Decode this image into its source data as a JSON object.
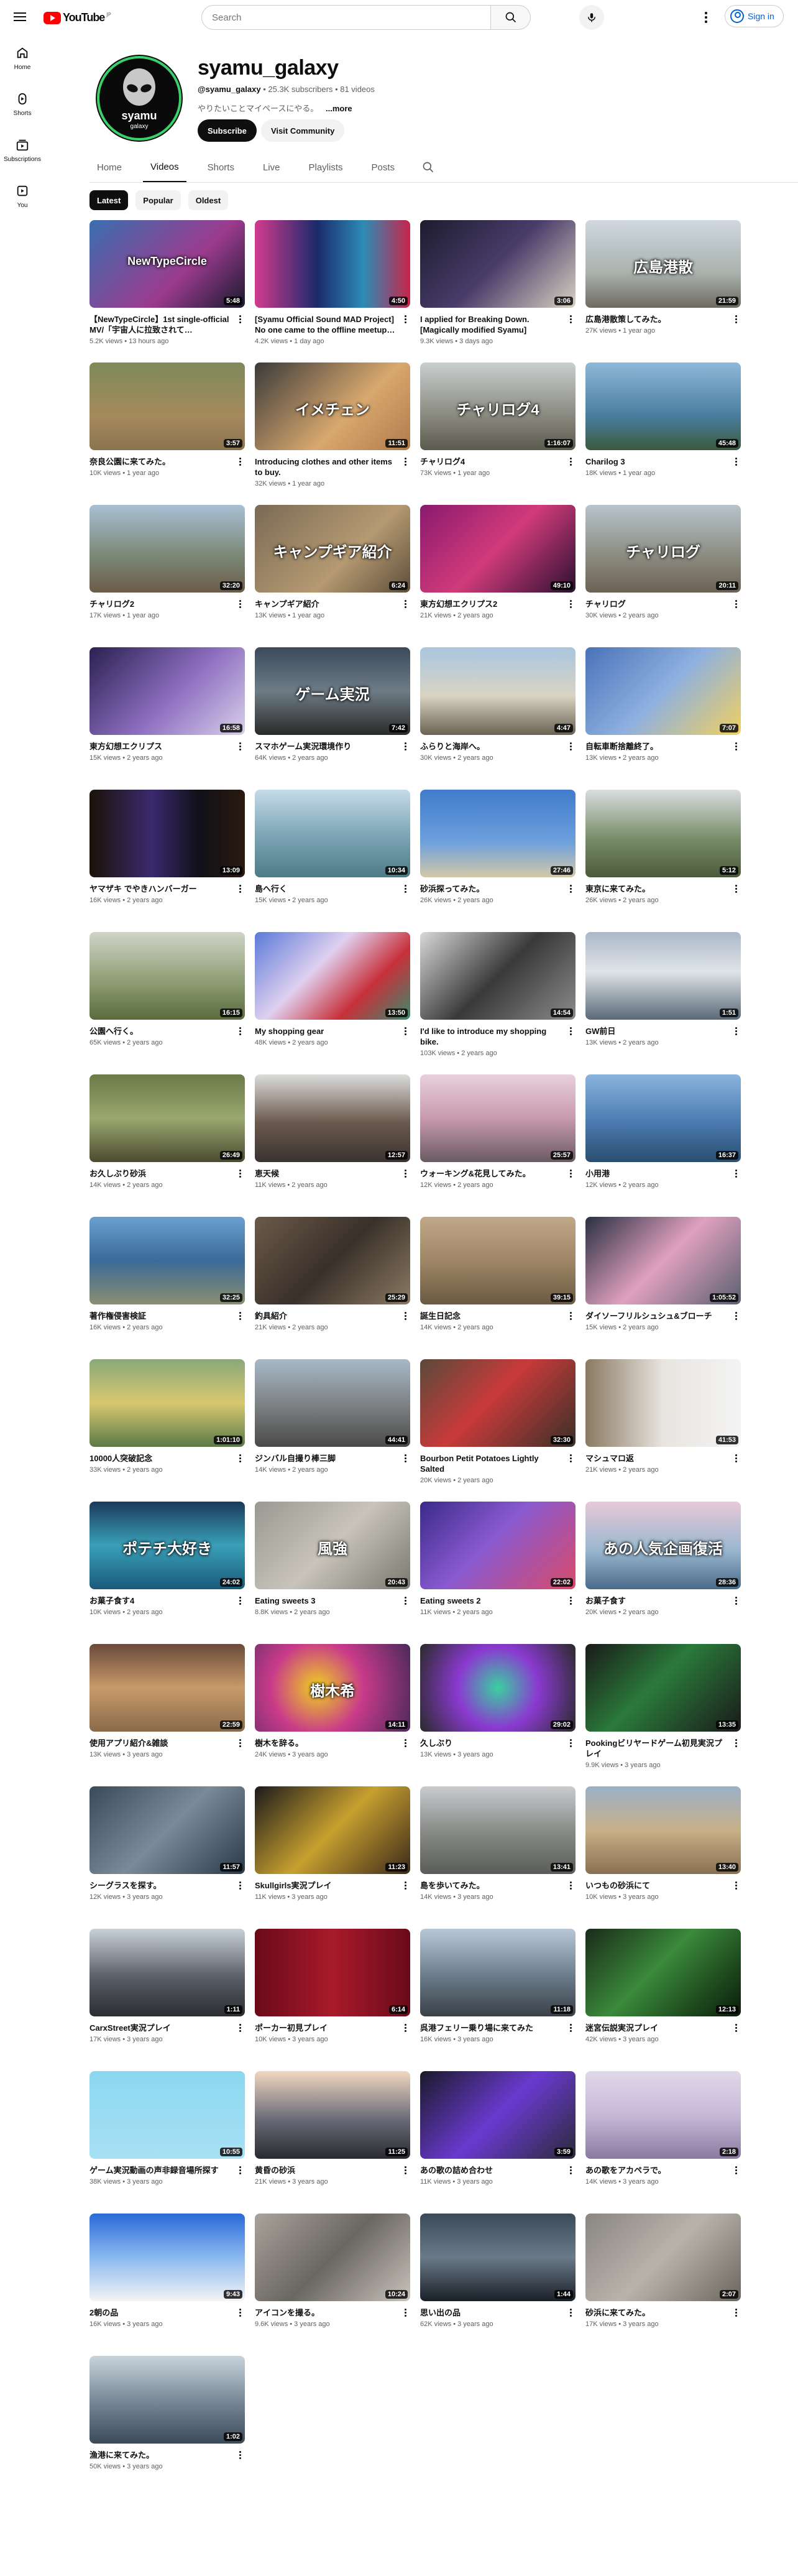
{
  "header": {
    "logo_text": "YouTube",
    "logo_country": "JP",
    "search_placeholder": "Search",
    "sign_in_label": "Sign in"
  },
  "sidebar": {
    "items": [
      {
        "label": "Home",
        "icon": "home-icon"
      },
      {
        "label": "Shorts",
        "icon": "shorts-icon"
      },
      {
        "label": "Subscriptions",
        "icon": "subscriptions-icon"
      },
      {
        "label": "You",
        "icon": "you-icon"
      }
    ]
  },
  "channel": {
    "name": "syamu_galaxy",
    "handle": "@syamu_galaxy",
    "subscribers": "25.3K subscribers",
    "videos": "81 videos",
    "description": "やりたいことマイペースにやる。",
    "more_label": "...more",
    "subscribe_label": "Subscribe",
    "community_label": "Visit Community",
    "avatar_text": "syamu",
    "avatar_subtext": "galaxy"
  },
  "tabs": [
    "Home",
    "Videos",
    "Shorts",
    "Live",
    "Playlists",
    "Posts"
  ],
  "active_tab": "Videos",
  "chips": [
    "Latest",
    "Popular",
    "Oldest"
  ],
  "active_chip": "Latest",
  "colors": {
    "accent": "#065fd4",
    "logo_red": "#ff0000",
    "text": "#0f0f0f",
    "muted": "#606060"
  },
  "videos": [
    {
      "title": "【NewTypeCircle】1st single-official MV/「宇宙人に拉致されて…",
      "meta": "5.2K views • 13 hours ago",
      "duration": "5:48",
      "thumb_text": "NewTypeCircle",
      "bg": "linear-gradient(135deg,#3a6fb0,#9c3b8e 60%,#1a1a2e)"
    },
    {
      "title": "[Syamu Official Sound MAD Project] No one came to the offline meetup…",
      "meta": "4.2K views • 1 day ago",
      "duration": "4:50",
      "thumb_text": "",
      "bg": "linear-gradient(90deg,#d23b8e,#1b2a6b 40%,#2d8bb6 70%,#c8244a)"
    },
    {
      "title": "I applied for Breaking Down. [Magically modified Syamu]",
      "meta": "9.3K views • 3 days ago",
      "duration": "3:06",
      "thumb_text": "",
      "bg": "linear-gradient(135deg,#1c1c2e,#4a3d6b 50%,#d9d2c0)"
    },
    {
      "title": "広島港散策してみた。",
      "meta": "27K views • 1 year ago",
      "duration": "21:59",
      "thumb_text": "広島港散",
      "bg": "linear-gradient(180deg,#cfd8e0,#a9b2ad 60%,#6e6a60)"
    },
    {
      "title": "奈良公園に来てみた。",
      "meta": "10K views • 1 year ago",
      "duration": "3:57",
      "thumb_text": "",
      "bg": "linear-gradient(180deg,#7d8a5a,#a58a5c 60%,#8a7350)"
    },
    {
      "title": "Introducing clothes and other items to buy.",
      "meta": "32K views • 1 year ago",
      "duration": "11:51",
      "thumb_text": "イメチェン",
      "bg": "linear-gradient(135deg,#3a3a3a,#d8a86e 60%,#b17a4c)"
    },
    {
      "title": "チャリログ4",
      "meta": "73K views • 1 year ago",
      "duration": "1:16:07",
      "thumb_text": "チャリログ4",
      "bg": "linear-gradient(180deg,#c9cfcf,#8a8a80 60%,#5a5a4e)"
    },
    {
      "title": "Charilog 3",
      "meta": "18K views • 1 year ago",
      "duration": "45:48",
      "thumb_text": "",
      "bg": "linear-gradient(180deg,#8fb8d8,#4a7ea0 60%,#3a5a3e)"
    },
    {
      "title": "チャリログ2",
      "meta": "17K views • 1 year ago",
      "duration": "32:20",
      "thumb_text": "",
      "bg": "linear-gradient(180deg,#a9bfd4,#7d8b7a 55%,#6a5b48)"
    },
    {
      "title": "キャンプギア紹介",
      "meta": "13K views • 1 year ago",
      "duration": "6:24",
      "thumb_text": "キャンプギア紹介",
      "bg": "linear-gradient(135deg,#7a6a55,#b59a72 60%,#5e4e3a)"
    },
    {
      "title": "東方幻想エクリプス2",
      "meta": "21K views • 2 years ago",
      "duration": "49:10",
      "thumb_text": "",
      "bg": "linear-gradient(135deg,#8a1a6e,#d13b7a 50%,#2a1030)"
    },
    {
      "title": "チャリログ",
      "meta": "30K views • 2 years ago",
      "duration": "20:11",
      "thumb_text": "チャリログ",
      "bg": "linear-gradient(180deg,#b7c4cc,#8a8a7e 60%,#6b6254)"
    },
    {
      "title": "東方幻想エクリプス",
      "meta": "15K views • 2 years ago",
      "duration": "16:58",
      "thumb_text": "",
      "bg": "linear-gradient(135deg,#2a2150,#8e6fc2 55%,#d8d0e8)"
    },
    {
      "title": "スマホゲーム実況環境作り",
      "meta": "64K views • 2 years ago",
      "duration": "7:42",
      "thumb_text": "ゲーム実況",
      "bg": "linear-gradient(180deg,#3b4a5a,#6e7c86 50%,#2a2a2a)"
    },
    {
      "title": "ふらりと海岸へ。",
      "meta": "30K views • 2 years ago",
      "duration": "4:47",
      "thumb_text": "",
      "bg": "linear-gradient(180deg,#a9c6df,#d9d4c4 55%,#6a6252)"
    },
    {
      "title": "自転車断捨離終了。",
      "meta": "13K views • 2 years ago",
      "duration": "7:07",
      "thumb_text": "",
      "bg": "linear-gradient(135deg,#4a72b8,#8eb0e0 50%,#f0d060)"
    },
    {
      "title": "ヤマザキ でやきハンバーガー",
      "meta": "16K views • 2 years ago",
      "duration": "13:09",
      "thumb_text": "",
      "bg": "linear-gradient(90deg,#1a1208,#3a2a6e 40%,#101018 70%,#2a1a10)"
    },
    {
      "title": "島へ行く",
      "meta": "15K views • 2 years ago",
      "duration": "10:34",
      "thumb_text": "",
      "bg": "linear-gradient(180deg,#c6dbe8,#7fa7b8 50%,#4e7a86)"
    },
    {
      "title": "砂浜探ってみた。",
      "meta": "26K views • 2 years ago",
      "duration": "27:46",
      "thumb_text": "",
      "bg": "linear-gradient(180deg,#3f7ccc,#6ea0dc 60%,#d4c8a8)"
    },
    {
      "title": "東京に来てみた。",
      "meta": "26K views • 2 years ago",
      "duration": "5:12",
      "thumb_text": "",
      "bg": "linear-gradient(180deg,#d8dee0,#7a8e6a 55%,#4a5a3a)"
    },
    {
      "title": "公園へ行く。",
      "meta": "65K views • 2 years ago",
      "duration": "16:15",
      "thumb_text": "",
      "bg": "linear-gradient(180deg,#cfd4c8,#8a9a6e 60%,#5a6b3e)"
    },
    {
      "title": "My shopping gear",
      "meta": "48K views • 2 years ago",
      "duration": "13:50",
      "thumb_text": "",
      "bg": "linear-gradient(135deg,#5a7ad8,#e0d0f0 40%,#c8303a 70%,#3a8a6e)"
    },
    {
      "title": "I'd like to introduce my shopping bike.",
      "meta": "103K views • 2 years ago",
      "duration": "14:54",
      "thumb_text": "",
      "bg": "linear-gradient(135deg,#d8d8d8,#3a3a3a 50%,#8a8a8a)"
    },
    {
      "title": "GW前日",
      "meta": "13K views • 2 years ago",
      "duration": "1:51",
      "thumb_text": "",
      "bg": "linear-gradient(180deg,#a9b8c8,#e0e4e8 45%,#5a6a78)"
    },
    {
      "title": "お久しぶり砂浜",
      "meta": "14K views • 2 years ago",
      "duration": "26:49",
      "thumb_text": "",
      "bg": "linear-gradient(180deg,#6a7a48,#9aa86e 50%,#4a4a30)"
    },
    {
      "title": "恵天候",
      "meta": "11K views • 2 years ago",
      "duration": "12:57",
      "thumb_text": "",
      "bg": "linear-gradient(180deg,#dcdcdc,#6a5a4e 55%,#3a3230)"
    },
    {
      "title": "ウォーキング&花見してみた。",
      "meta": "12K views • 2 years ago",
      "duration": "25:57",
      "thumb_text": "",
      "bg": "linear-gradient(180deg,#e8d0dc,#c89aae 50%,#6a5a62)"
    },
    {
      "title": "小用港",
      "meta": "12K views • 2 years ago",
      "duration": "16:37",
      "thumb_text": "",
      "bg": "linear-gradient(180deg,#8ab4de,#4a7ab0 55%,#2a4e6e)"
    },
    {
      "title": "著作権侵害検証",
      "meta": "16K views • 2 years ago",
      "duration": "32:25",
      "thumb_text": "",
      "bg": "linear-gradient(180deg,#6aa0d0,#3a6a98 50%,#8a8e70)"
    },
    {
      "title": "釣具紹介",
      "meta": "21K views • 2 years ago",
      "duration": "25:29",
      "thumb_text": "",
      "bg": "linear-gradient(135deg,#6a5a48,#3a302a 50%,#8a7a62)"
    },
    {
      "title": "誕生日記念",
      "meta": "14K views • 2 years ago",
      "duration": "39:15",
      "thumb_text": "",
      "bg": "linear-gradient(180deg,#c0a888,#9a8262 55%,#6a5a42)"
    },
    {
      "title": "ダイソーフリルシュシュ&ブローチ",
      "meta": "15K views • 2 years ago",
      "duration": "1:05:52",
      "thumb_text": "",
      "bg": "linear-gradient(135deg,#2a3040,#e0a0c0 50%,#5a6070)"
    },
    {
      "title": "10000人突破記念",
      "meta": "33K views • 2 years ago",
      "duration": "1:01:10",
      "thumb_text": "",
      "bg": "linear-gradient(180deg,#8aa87a,#d8c870 50%,#5a7a48)"
    },
    {
      "title": "ジンバル自撮り棒三脚",
      "meta": "14K views • 2 years ago",
      "duration": "44:41",
      "thumb_text": "",
      "bg": "linear-gradient(180deg,#a8b8c8,#7a7e80 55%,#4a4a48)"
    },
    {
      "title": "Bourbon Petit Potatoes Lightly Salted",
      "meta": "20K views • 2 years ago",
      "duration": "32:30",
      "thumb_text": "",
      "bg": "linear-gradient(135deg,#5a4a3a,#c83a3a 45%,#3a3028)"
    },
    {
      "title": "マシュマロ返",
      "meta": "21K views • 2 years ago",
      "duration": "41:53",
      "thumb_text": "",
      "bg": "linear-gradient(90deg,#8a7a62,#e8e4e0 50%,#f4f4f4)"
    },
    {
      "title": "お菓子食す4",
      "meta": "10K views • 2 years ago",
      "duration": "24:02",
      "thumb_text": "ポテチ大好き",
      "bg": "linear-gradient(180deg,#1a3a5a,#3aa0b8 50%,#1a5a7a)"
    },
    {
      "title": "Eating sweets 3",
      "meta": "8.8K views • 2 years ago",
      "duration": "20:43",
      "thumb_text": "風強",
      "bg": "linear-gradient(135deg,#9a9890,#c8c4bc 50%,#7a7870)"
    },
    {
      "title": "Eating sweets 2",
      "meta": "11K views • 2 years ago",
      "duration": "22:02",
      "thumb_text": "",
      "bg": "linear-gradient(135deg,#3a2a8a,#8a5ad0 45%,#d84a6a)"
    },
    {
      "title": "お菓子食す",
      "meta": "20K views • 2 years ago",
      "duration": "28:36",
      "thumb_text": "あの人気企画復活",
      "bg": "linear-gradient(180deg,#e8c8d8,#9ab8d0 55%,#4a6a8a)"
    },
    {
      "title": "使用アプリ紹介&雑談",
      "meta": "13K views • 3 years ago",
      "duration": "22:59",
      "thumb_text": "",
      "bg": "linear-gradient(180deg,#6a4a3a,#c89a6a 50%,#8a6a4a)"
    },
    {
      "title": "樹木を辞る。",
      "meta": "24K views • 3 years ago",
      "duration": "14:11",
      "thumb_text": "樹木希",
      "bg": "radial-gradient(circle at 40% 50%,#f0d020,#c83a8a 45%,#4a2a5a)"
    },
    {
      "title": "久しぶり",
      "meta": "13K views • 3 years ago",
      "duration": "29:02",
      "thumb_text": "",
      "bg": "radial-gradient(circle at 50% 50%,#3ad0a0,#8a3ad0 45%,#2a2a2a)"
    },
    {
      "title": "Pookingビリヤードゲーム初見実況プレイ",
      "meta": "9.9K views • 3 years ago",
      "duration": "13:35",
      "thumb_text": "",
      "bg": "linear-gradient(135deg,#1a1a1a,#2a7a3a 45%,#1a1a1a)"
    },
    {
      "title": "シーグラスを探す。",
      "meta": "12K views • 3 years ago",
      "duration": "11:57",
      "thumb_text": "",
      "bg": "linear-gradient(135deg,#3a4a5a,#7a8a98 50%,#2a3a48)"
    },
    {
      "title": "Skullgirls実況プレイ",
      "meta": "11K views • 3 years ago",
      "duration": "11:23",
      "thumb_text": "",
      "bg": "linear-gradient(135deg,#1a1a1a,#c8a030 50%,#3a2a1a)"
    },
    {
      "title": "島を歩いてみた。",
      "meta": "14K views • 3 years ago",
      "duration": "13:41",
      "thumb_text": "",
      "bg": "linear-gradient(180deg,#c8ccd0,#8a8c88 50%,#5a5c58)"
    },
    {
      "title": "いつもの砂浜にて",
      "meta": "10K views • 3 years ago",
      "duration": "13:40",
      "thumb_text": "",
      "bg": "linear-gradient(180deg,#9ab0c8,#c8b088 50%,#8a7052)"
    },
    {
      "title": "CarxStreet実況プレイ",
      "meta": "17K views • 3 years ago",
      "duration": "1:11",
      "thumb_text": "",
      "bg": "linear-gradient(180deg,#c8d0d8,#5a6068 55%,#2a2c30)"
    },
    {
      "title": "ポーカー初見プレイ",
      "meta": "10K views • 3 years ago",
      "duration": "6:14",
      "thumb_text": "",
      "bg": "linear-gradient(90deg,#6a0a1a,#a81a2a 50%,#6a0a1a)"
    },
    {
      "title": "呉港フェリー乗り場に来てみた",
      "meta": "16K views • 3 years ago",
      "duration": "11:18",
      "thumb_text": "",
      "bg": "linear-gradient(180deg,#b8c8d8,#6a7a88 55%,#3a4048)"
    },
    {
      "title": "迷宮伝説実況プレイ",
      "meta": "42K views • 3 years ago",
      "duration": "12:13",
      "thumb_text": "",
      "bg": "linear-gradient(135deg,#1a2a1a,#3a8a3a 45%,#0a1a0a)"
    },
    {
      "title": "ゲーム実況動画の声非録音場所探す",
      "meta": "38K views • 3 years ago",
      "duration": "10:55",
      "thumb_text": "",
      "bg": "linear-gradient(180deg,#8ad8f0,#a8e0f4)"
    },
    {
      "title": "黄昏の砂浜",
      "meta": "21K views • 3 years ago",
      "duration": "11:25",
      "thumb_text": "",
      "bg": "linear-gradient(180deg,#f0d8c0,#6a6a78 55%,#2a2a30)"
    },
    {
      "title": "あの歌の詰め合わせ",
      "meta": "11K views • 3 years ago",
      "duration": "3:59",
      "thumb_text": "",
      "bg": "linear-gradient(135deg,#1a1a2a,#6a3ad0 50%,#2a2a3a)"
    },
    {
      "title": "あの歌をアカペラで。",
      "meta": "14K views • 3 years ago",
      "duration": "2:18",
      "thumb_text": "",
      "bg": "linear-gradient(180deg,#e0d8e8,#c8b8d8 50%,#8a7aa0)"
    },
    {
      "title": "2朝の品",
      "meta": "16K views • 3 years ago",
      "duration": "9:43",
      "thumb_text": "",
      "bg": "linear-gradient(180deg,#2a6ad8,#8ab8f0 50%,#f4f4f4)"
    },
    {
      "title": "アイコンを撮る。",
      "meta": "9.6K views • 3 years ago",
      "duration": "10:24",
      "thumb_text": "",
      "bg": "linear-gradient(135deg,#a8a49c,#6a6660 50%,#c8c4bc)"
    },
    {
      "title": "思い出の品",
      "meta": "62K views • 3 years ago",
      "duration": "1:44",
      "thumb_text": "",
      "bg": "linear-gradient(180deg,#3a4a58,#6a7a88 50%,#1a2028)"
    },
    {
      "title": "砂浜に来てみた。",
      "meta": "17K views • 3 years ago",
      "duration": "2:07",
      "thumb_text": "",
      "bg": "linear-gradient(135deg,#8a8680,#b8b4ac 50%,#6a665e)"
    },
    {
      "title": "漁港に来てみた。",
      "meta": "50K views • 3 years ago",
      "duration": "1:02",
      "thumb_text": "",
      "bg": "linear-gradient(180deg,#c8d4dc,#7a8a98 50%,#3a4a58)"
    }
  ]
}
